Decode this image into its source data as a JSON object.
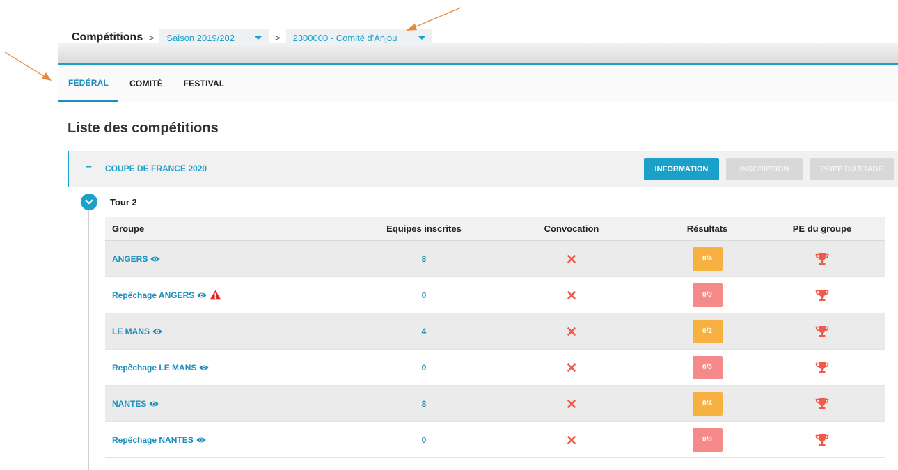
{
  "breadcrumb": {
    "title": "Compétitions",
    "sep1": ">",
    "sep2": ">",
    "season": "Saison 2019/202",
    "committee": "2300000 - Comité d'Anjou"
  },
  "tabs": [
    {
      "label": "FÉDÉRAL",
      "active": true
    },
    {
      "label": "COMITÉ",
      "active": false
    },
    {
      "label": "FESTIVAL",
      "active": false
    }
  ],
  "page_title": "Liste des compétitions",
  "competition": {
    "toggle": "–",
    "title": "COUPE DE FRANCE 2020",
    "buttons": {
      "information": "INFORMATION",
      "inscription": "INSCRIPTION",
      "pe_pp": "PE/PP DU STADE"
    }
  },
  "tour": {
    "label": "Tour 2"
  },
  "table": {
    "headers": [
      "Groupe",
      "Equipes inscrites",
      "Convocation",
      "Résultats",
      "PE du groupe"
    ],
    "rows": [
      {
        "group": "ANGERS",
        "teams": "8",
        "convocation": "✕",
        "result": "0/4",
        "result_status": "orange",
        "warning": false
      },
      {
        "group": "Repêchage ANGERS",
        "teams": "0",
        "convocation": "✕",
        "result": "0/0",
        "result_status": "red",
        "warning": true
      },
      {
        "group": "LE MANS",
        "teams": "4",
        "convocation": "✕",
        "result": "0/2",
        "result_status": "orange",
        "warning": false
      },
      {
        "group": "Repêchage LE MANS",
        "teams": "0",
        "convocation": "✕",
        "result": "0/0",
        "result_status": "red",
        "warning": false
      },
      {
        "group": "NANTES",
        "teams": "8",
        "convocation": "✕",
        "result": "0/4",
        "result_status": "orange",
        "warning": false
      },
      {
        "group": "Repêchage NANTES",
        "teams": "0",
        "convocation": "✕",
        "result": "0/0",
        "result_status": "red",
        "warning": false
      }
    ]
  },
  "colors": {
    "accent": "#1aa0c9",
    "result_orange": "#f7b141",
    "result_red": "#f58a8a",
    "cross_red": "#f05a4a",
    "trophy_red": "#f05a4a",
    "annotation_arrow": "#e8893a"
  },
  "icons": {
    "view": "eye-icon",
    "warning": "warning-triangle-icon",
    "convocation": "cross-icon",
    "pe": "trophy-icon",
    "tour_toggle": "chevron-down-icon"
  }
}
